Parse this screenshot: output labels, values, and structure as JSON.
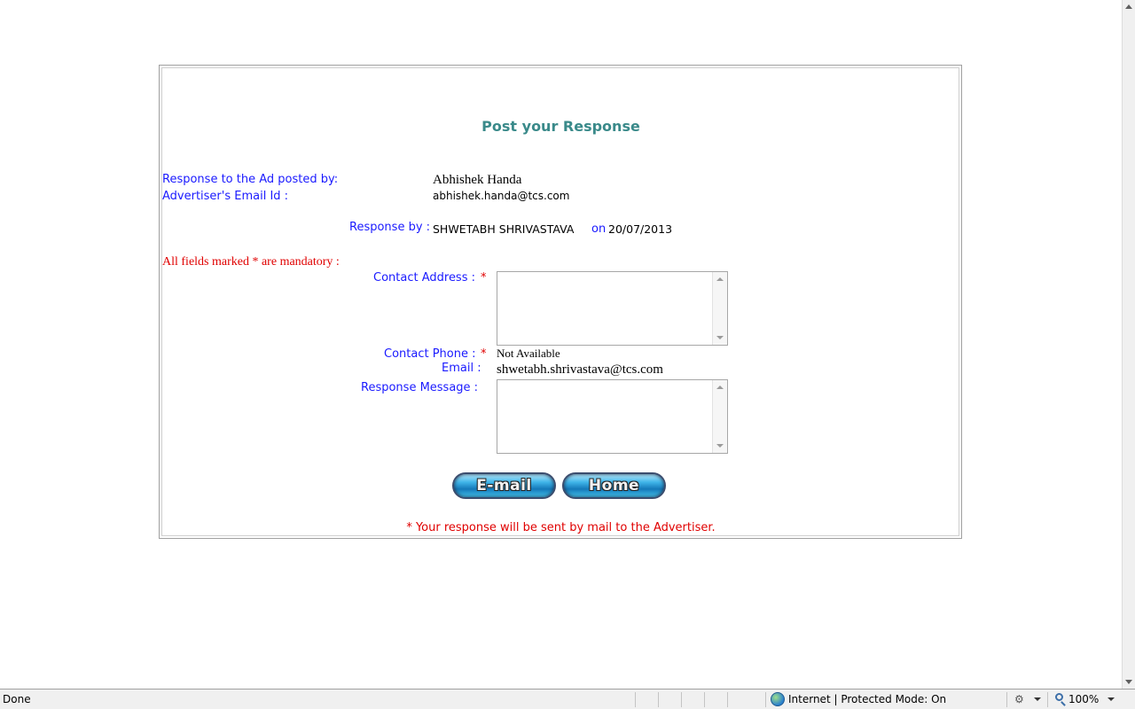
{
  "form": {
    "title": "Post your Response",
    "ad_posted_by_label": "Response to the Ad posted by:",
    "ad_posted_by_value": "Abhishek Handa",
    "advertiser_email_label": "Advertiser's Email Id :",
    "advertiser_email_value": "abhishek.handa@tcs.com",
    "response_by_label": "Response by :",
    "response_by_value": "SHWETABH SHRIVASTAVA",
    "on_label": "on",
    "response_date": "20/07/2013",
    "mandatory_note": "All fields marked * are mandatory :",
    "contact_address_label": "Contact Address :",
    "contact_address_value": "",
    "required_marker": "*",
    "contact_phone_label": "Contact Phone :",
    "contact_phone_value": "Not Available",
    "email_label": "Email :",
    "email_value": "shwetabh.shrivastava@tcs.com",
    "response_message_label": "Response Message :",
    "response_message_value": "",
    "email_button": "E-mail",
    "home_button": "Home",
    "footer_note": "* Your response will be sent by mail to the Advertiser."
  },
  "statusbar": {
    "status": "Done",
    "zone": "Internet | Protected Mode: On",
    "zoom": "100%"
  },
  "colors": {
    "title": "#3a8a8a",
    "label": "#1a1aff",
    "required": "#e00000"
  }
}
